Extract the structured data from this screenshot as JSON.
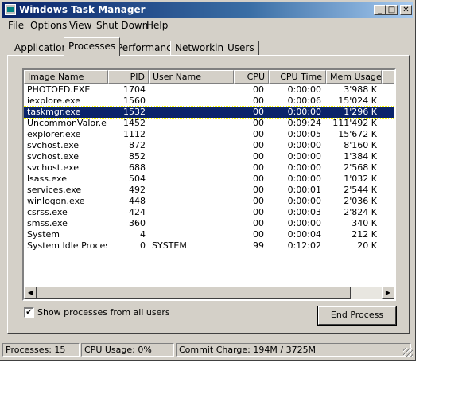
{
  "window": {
    "title": "Windows Task Manager",
    "controls": {
      "minimize": "_",
      "maximize": "□",
      "close": "✕"
    }
  },
  "menu": [
    "File",
    "Options",
    "View",
    "Shut Down",
    "Help"
  ],
  "tabs": [
    "Applications",
    "Processes",
    "Performance",
    "Networking",
    "Users"
  ],
  "active_tab": "Processes",
  "columns": [
    "Image Name",
    "PID",
    "User Name",
    "CPU",
    "CPU Time",
    "Mem Usage"
  ],
  "processes": [
    {
      "image": "PHOTOED.EXE",
      "pid": "1704",
      "user": "",
      "cpu": "00",
      "cpu_time": "0:00:00",
      "mem": "3'988 K"
    },
    {
      "image": "iexplore.exe",
      "pid": "1560",
      "user": "",
      "cpu": "00",
      "cpu_time": "0:00:06",
      "mem": "15'024 K"
    },
    {
      "image": "taskmgr.exe",
      "pid": "1532",
      "user": "",
      "cpu": "00",
      "cpu_time": "0:00:00",
      "mem": "1'296 K"
    },
    {
      "image": "UncommonValor.exe",
      "pid": "1452",
      "user": "",
      "cpu": "00",
      "cpu_time": "0:09:24",
      "mem": "111'492 K"
    },
    {
      "image": "explorer.exe",
      "pid": "1112",
      "user": "",
      "cpu": "00",
      "cpu_time": "0:00:05",
      "mem": "15'672 K"
    },
    {
      "image": "svchost.exe",
      "pid": "872",
      "user": "",
      "cpu": "00",
      "cpu_time": "0:00:00",
      "mem": "8'160 K"
    },
    {
      "image": "svchost.exe",
      "pid": "852",
      "user": "",
      "cpu": "00",
      "cpu_time": "0:00:00",
      "mem": "1'384 K"
    },
    {
      "image": "svchost.exe",
      "pid": "688",
      "user": "",
      "cpu": "00",
      "cpu_time": "0:00:00",
      "mem": "2'568 K"
    },
    {
      "image": "lsass.exe",
      "pid": "504",
      "user": "",
      "cpu": "00",
      "cpu_time": "0:00:00",
      "mem": "1'032 K"
    },
    {
      "image": "services.exe",
      "pid": "492",
      "user": "",
      "cpu": "00",
      "cpu_time": "0:00:01",
      "mem": "2'544 K"
    },
    {
      "image": "winlogon.exe",
      "pid": "448",
      "user": "",
      "cpu": "00",
      "cpu_time": "0:00:00",
      "mem": "2'036 K"
    },
    {
      "image": "csrss.exe",
      "pid": "424",
      "user": "",
      "cpu": "00",
      "cpu_time": "0:00:03",
      "mem": "2'824 K"
    },
    {
      "image": "smss.exe",
      "pid": "360",
      "user": "",
      "cpu": "00",
      "cpu_time": "0:00:00",
      "mem": "340 K"
    },
    {
      "image": "System",
      "pid": "4",
      "user": "",
      "cpu": "00",
      "cpu_time": "0:00:04",
      "mem": "212 K"
    },
    {
      "image": "System Idle Process",
      "pid": "0",
      "user": "SYSTEM",
      "cpu": "99",
      "cpu_time": "0:12:02",
      "mem": "20 K"
    }
  ],
  "selected_image": "taskmgr.exe",
  "show_all_users": {
    "label": "Show processes from all users",
    "checked": true,
    "mark": "✔"
  },
  "end_process_label": "End Process",
  "status": {
    "processes": "Processes: 15",
    "cpu_usage": "CPU Usage: 0%",
    "commit_charge": "Commit Charge: 194M / 3725M"
  },
  "colors": {
    "title_bar": "#0a246a",
    "face": "#d4d0c8",
    "selection": "#0a246a"
  }
}
